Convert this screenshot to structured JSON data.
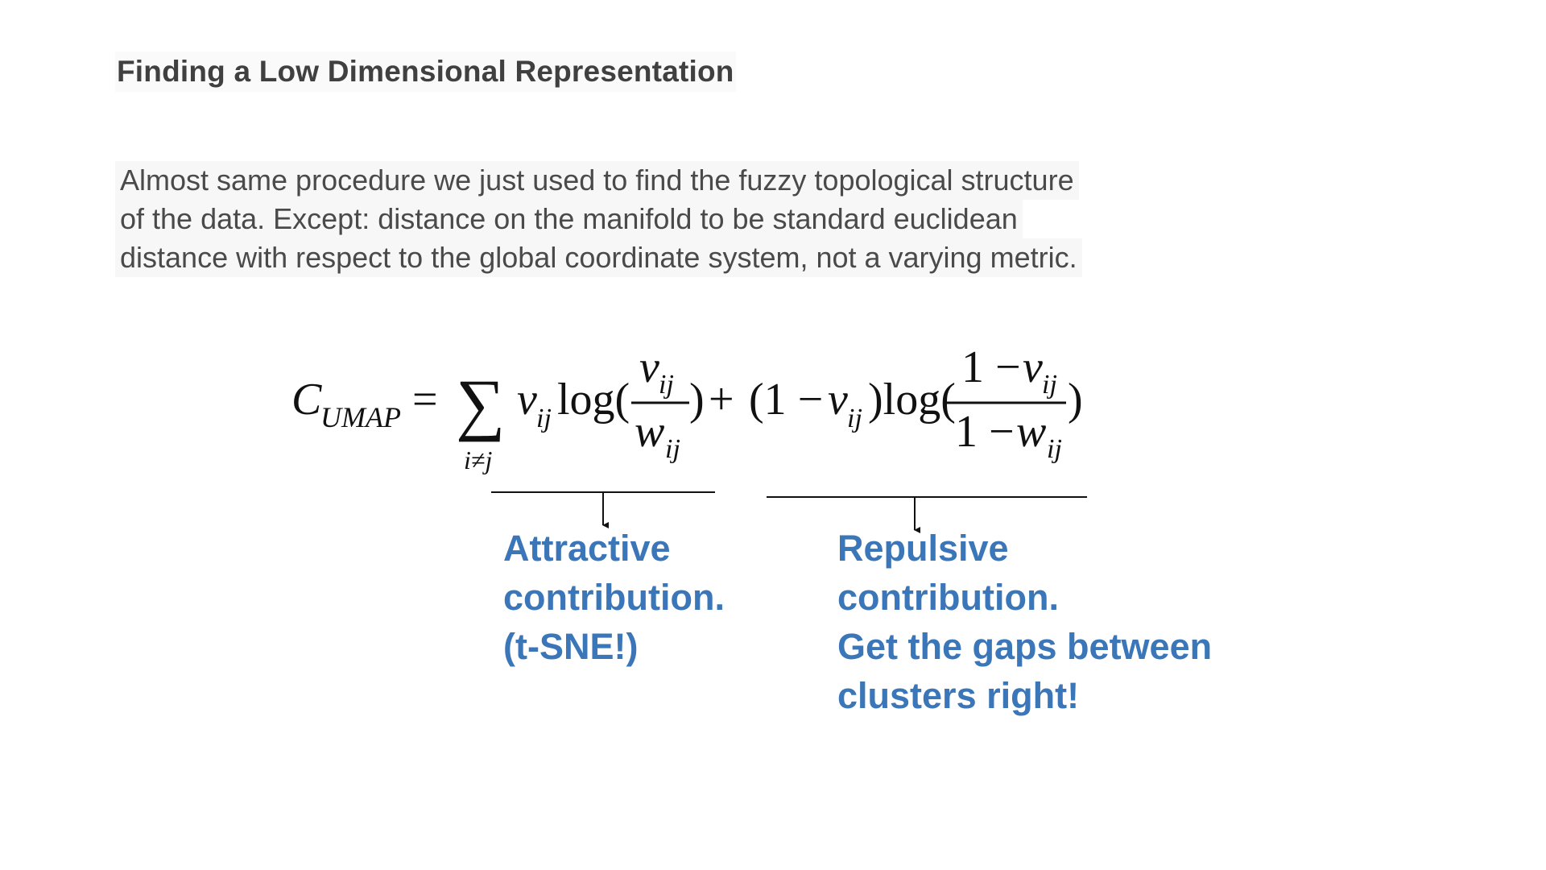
{
  "slide": {
    "title": "Finding a Low Dimensional Representation",
    "body_lines": [
      "Almost same procedure we just used to find the fuzzy topological structure",
      "of the data. Except: distance on the manifold to be standard euclidean",
      "distance with respect to the global coordinate system, not a varying metric."
    ]
  },
  "formula": {
    "cost_symbol": "C",
    "cost_subscript": "UMAP",
    "equals": "=",
    "sum_symbol": "∑",
    "sum_index": "i≠j",
    "v": "v",
    "w": "w",
    "ij": "ij",
    "log": "log(",
    "close_paren": ")",
    "plus": "+",
    "one_minus_open": "(1 −",
    "one_minus": "1 −",
    "close_log": ")log("
  },
  "annotations": {
    "attractive": {
      "lines": [
        "Attractive",
        "contribution.",
        "(t-SNE!)"
      ]
    },
    "repulsive": {
      "lines": [
        "Repulsive",
        "contribution.",
        "Get the gaps between",
        "clusters right!"
      ]
    }
  },
  "colors": {
    "accent_blue": "#3a76b8",
    "body_text": "#4a4a4a",
    "title_text": "#404040"
  }
}
